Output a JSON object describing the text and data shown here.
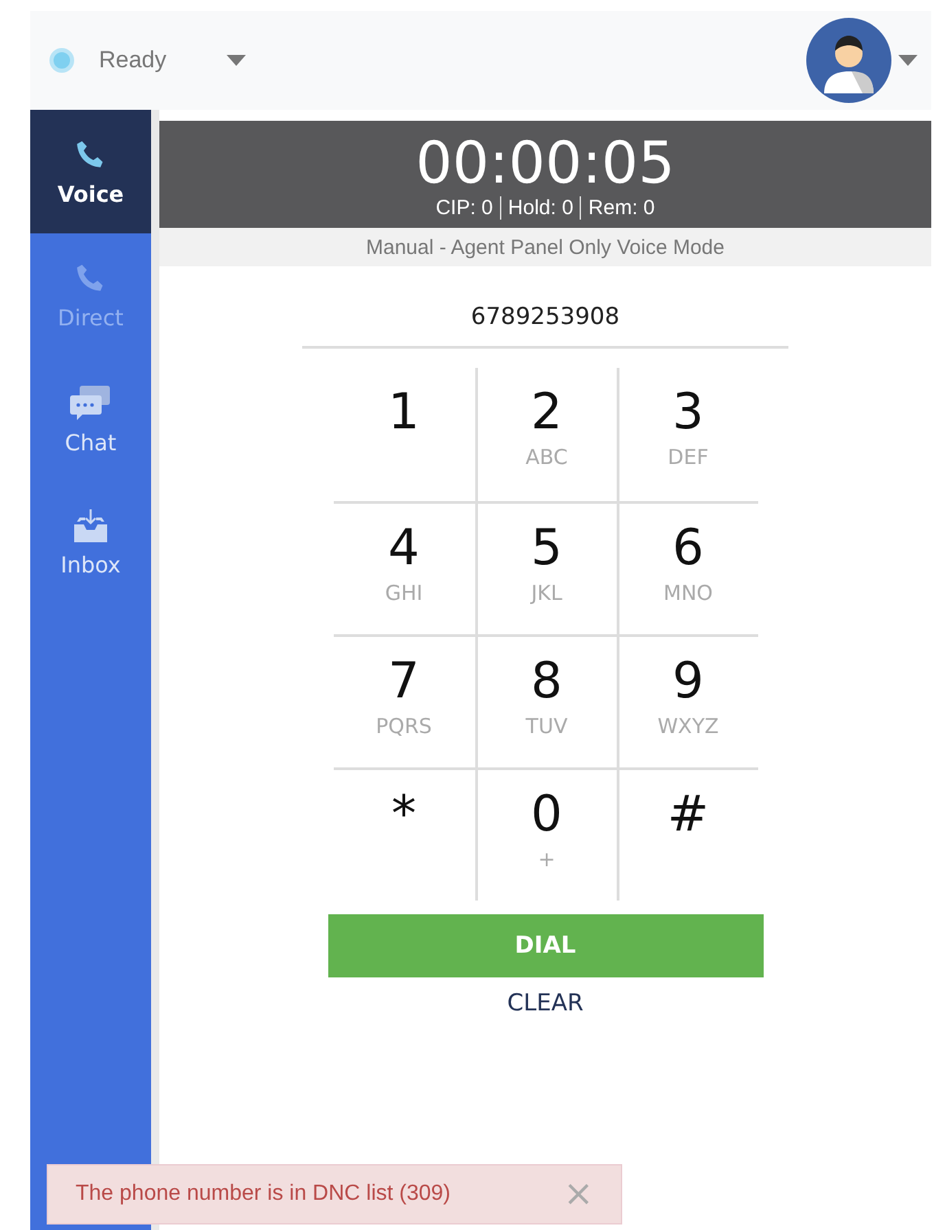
{
  "header": {
    "status": {
      "label": "Ready",
      "color": "#7fd0f0"
    }
  },
  "sidebar": {
    "items": [
      {
        "label": "Voice",
        "kind": "voice",
        "selected": true,
        "disabled": false
      },
      {
        "label": "Direct",
        "kind": "voice",
        "selected": false,
        "disabled": true
      },
      {
        "label": "Chat",
        "kind": "chat",
        "selected": false,
        "disabled": false
      },
      {
        "label": "Inbox",
        "kind": "inbox",
        "selected": false,
        "disabled": false
      }
    ]
  },
  "timer": {
    "time": "00:00:05",
    "counters": [
      "CIP: 0",
      "Hold: 0",
      "Rem: 0"
    ]
  },
  "mode": "Manual - Agent Panel Only Voice Mode",
  "dialer": {
    "number": "6789253908",
    "keys": [
      {
        "digit": "1"
      },
      {
        "digit": "2",
        "letters": "ABC"
      },
      {
        "digit": "3",
        "letters": "DEF"
      },
      {
        "digit": "4",
        "letters": "GHI"
      },
      {
        "digit": "5",
        "letters": "JKL"
      },
      {
        "digit": "6",
        "letters": "MNO"
      },
      {
        "digit": "7",
        "letters": "PQRS"
      },
      {
        "digit": "8",
        "letters": "TUV"
      },
      {
        "digit": "9",
        "letters": "WXYZ"
      },
      {
        "digit": "*"
      },
      {
        "digit": "0",
        "letters": "+"
      },
      {
        "digit": "#"
      }
    ],
    "dial": "DIAL",
    "clear": "CLEAR"
  },
  "toast": {
    "message": "The phone number is in DNC list (309)",
    "close": "×"
  }
}
